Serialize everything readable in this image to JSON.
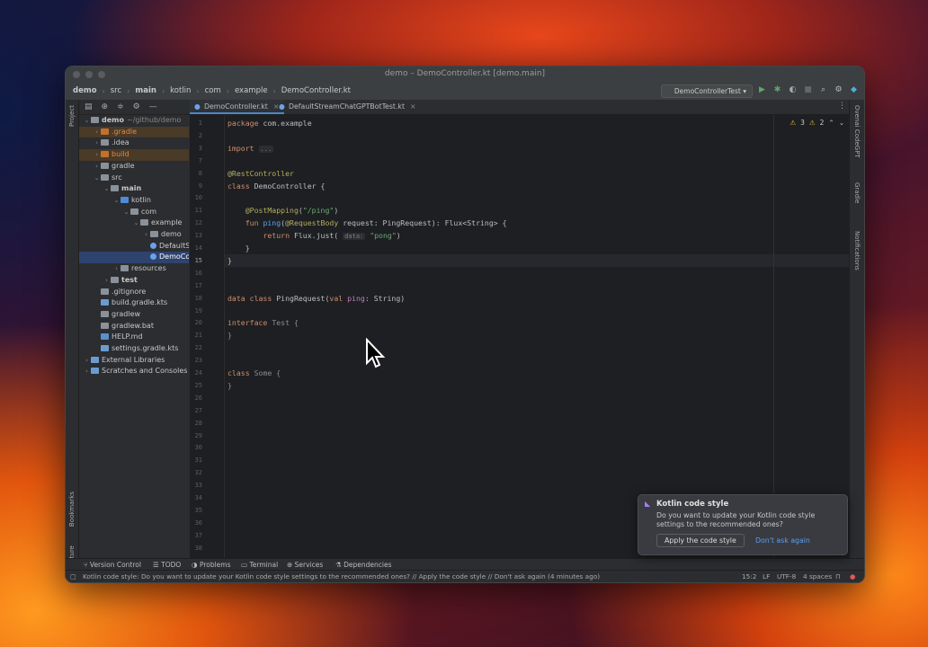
{
  "window": {
    "title": "demo – DemoController.kt [demo.main]"
  },
  "breadcrumbs": [
    "demo",
    "src",
    "main",
    "kotlin",
    "com",
    "example",
    "DemoController.kt"
  ],
  "run_config": "DemoControllerTest",
  "project_panel": {
    "side_label": "Project",
    "tree": [
      {
        "label": "demo",
        "suffix": "~/github/demo",
        "depth": 0,
        "arrow": "open",
        "bold": true,
        "icon": "folder"
      },
      {
        "label": ".gradle",
        "depth": 1,
        "arrow": "closed",
        "icon": "folder-orange",
        "hl": "orange"
      },
      {
        "label": ".idea",
        "depth": 1,
        "arrow": "closed",
        "icon": "folder"
      },
      {
        "label": "build",
        "depth": 1,
        "arrow": "closed",
        "icon": "folder-orange",
        "hl": "orange"
      },
      {
        "label": "gradle",
        "depth": 1,
        "arrow": "closed",
        "icon": "folder"
      },
      {
        "label": "src",
        "depth": 1,
        "arrow": "open",
        "icon": "folder"
      },
      {
        "label": "main",
        "depth": 2,
        "arrow": "open",
        "bold": true,
        "icon": "folder"
      },
      {
        "label": "kotlin",
        "depth": 3,
        "arrow": "open",
        "icon": "folder-blue"
      },
      {
        "label": "com",
        "depth": 4,
        "arrow": "open",
        "icon": "folder"
      },
      {
        "label": "example",
        "depth": 5,
        "arrow": "open",
        "icon": "folder"
      },
      {
        "label": "demo",
        "depth": 6,
        "arrow": "closed",
        "icon": "folder"
      },
      {
        "label": "DefaultStreamChatGPTBotTest",
        "depth": 6,
        "arrow": "none",
        "icon": "kotlin"
      },
      {
        "label": "DemoController",
        "depth": 6,
        "arrow": "none",
        "icon": "kotlin",
        "hl": "sel"
      },
      {
        "label": "resources",
        "depth": 3,
        "arrow": "closed",
        "icon": "folder"
      },
      {
        "label": "test",
        "depth": 2,
        "arrow": "closed",
        "bold": true,
        "icon": "folder"
      },
      {
        "label": ".gitignore",
        "depth": 1,
        "arrow": "none",
        "icon": "file"
      },
      {
        "label": "build.gradle.kts",
        "depth": 1,
        "arrow": "none",
        "icon": "gradle"
      },
      {
        "label": "gradlew",
        "depth": 1,
        "arrow": "none",
        "icon": "file"
      },
      {
        "label": "gradlew.bat",
        "depth": 1,
        "arrow": "none",
        "icon": "file"
      },
      {
        "label": "HELP.md",
        "depth": 1,
        "arrow": "none",
        "icon": "md"
      },
      {
        "label": "settings.gradle.kts",
        "depth": 1,
        "arrow": "none",
        "icon": "gradle"
      },
      {
        "label": "External Libraries",
        "depth": 0,
        "arrow": "closed",
        "icon": "lib"
      },
      {
        "label": "Scratches and Consoles",
        "depth": 0,
        "arrow": "closed",
        "icon": "scratch"
      }
    ]
  },
  "tabs": [
    {
      "label": "DemoController.kt",
      "active": true
    },
    {
      "label": "DefaultStreamChatGPTBotTest.kt",
      "active": false
    }
  ],
  "inspections": {
    "warnings": "3",
    "weak": "2"
  },
  "code": {
    "current_line": 15,
    "lines": [
      {
        "n": 1,
        "html": "<span class='kw'>package</span> com.example"
      },
      {
        "n": 2,
        "html": ""
      },
      {
        "n": 3,
        "html": "<span class='kw'>import</span> <span class='hint'>...</span>"
      },
      {
        "n": 7,
        "html": ""
      },
      {
        "n": 8,
        "html": "<span class='ann'>@RestController</span>"
      },
      {
        "n": 9,
        "html": "<span class='kw'>class</span> DemoController {"
      },
      {
        "n": 10,
        "html": ""
      },
      {
        "n": 11,
        "html": "    <span class='ann'>@PostMapping</span>(<span class='str'>\"/ping\"</span>)"
      },
      {
        "n": 12,
        "html": "    <span class='kw'>fun</span> <span class='fn'>ping</span>(<span class='ann'>@RequestBody</span> request: PingRequest): Flux&lt;String&gt; {"
      },
      {
        "n": 13,
        "html": "        <span class='kw'>return</span> Flux.just( <span class='hint'>data:</span> <span class='str'>\"pong\"</span>)"
      },
      {
        "n": 14,
        "html": "    }"
      },
      {
        "n": 15,
        "html": "}"
      },
      {
        "n": 16,
        "html": ""
      },
      {
        "n": 17,
        "html": ""
      },
      {
        "n": 18,
        "html": "<span class='kw'>data class</span> PingRequest(<span class='kw'>val</span> <span class='prop'>ping</span>: String)"
      },
      {
        "n": 19,
        "html": ""
      },
      {
        "n": 20,
        "html": "<span class='kw'>interface</span> <span class='dim'>Test {</span>"
      },
      {
        "n": 21,
        "html": "<span class='dim'>}</span>"
      },
      {
        "n": 22,
        "html": ""
      },
      {
        "n": 23,
        "html": ""
      },
      {
        "n": 24,
        "html": "<span class='kw'>class</span> <span class='dim'>Some {</span>"
      },
      {
        "n": 25,
        "html": "<span class='dim'>}</span>"
      },
      {
        "n": 26,
        "html": ""
      },
      {
        "n": 27,
        "html": ""
      },
      {
        "n": 28,
        "html": ""
      },
      {
        "n": 29,
        "html": ""
      },
      {
        "n": 30,
        "html": ""
      },
      {
        "n": 31,
        "html": ""
      },
      {
        "n": 32,
        "html": ""
      },
      {
        "n": 33,
        "html": ""
      },
      {
        "n": 34,
        "html": ""
      },
      {
        "n": 35,
        "html": ""
      },
      {
        "n": 36,
        "html": ""
      },
      {
        "n": 37,
        "html": ""
      },
      {
        "n": 38,
        "html": ""
      }
    ]
  },
  "right_tools": [
    "Ovenai CodeGPT",
    "Gradle",
    "Notifications"
  ],
  "left_tools_bottom": [
    "Bookmarks",
    "Structure"
  ],
  "bottom_tools": [
    "Version Control",
    "TODO",
    "Problems",
    "Terminal",
    "Services",
    "Dependencies"
  ],
  "status": {
    "message": "Kotlin code style: Do you want to update your Kotlin code style settings to the recommended ones? // Apply the code style // Don't ask again (4 minutes ago)",
    "position": "15:2",
    "line_sep": "LF",
    "encoding": "UTF-8",
    "indent": "4 spaces"
  },
  "notification": {
    "title": "Kotlin code style",
    "body": "Do you want to update your Kotlin code style settings to the recommended ones?",
    "apply": "Apply the code style",
    "dismiss": "Don't ask again"
  }
}
